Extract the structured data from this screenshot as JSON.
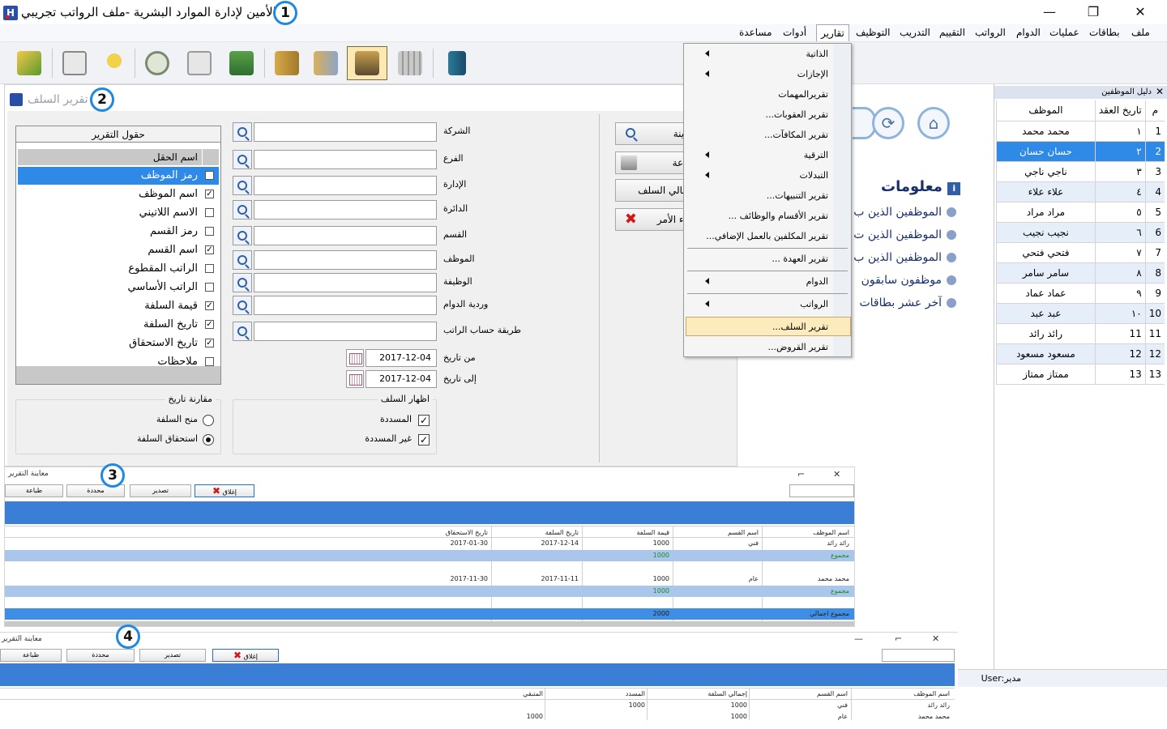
{
  "app": {
    "title": "الأمين لإدارة الموارد البشرية -ملف الرواتب تجريبي",
    "logo_letter": "H"
  },
  "window_controls": {
    "minimize": "—",
    "maximize": "❐",
    "close": "✕"
  },
  "badges": [
    "1",
    "2",
    "3",
    "4"
  ],
  "menubar": [
    "ملف",
    "بطاقات",
    "عمليات",
    "الدوام",
    "الرواتب",
    "التقييم",
    "التدريب",
    "التوظيف",
    "تقارير",
    "أدوات",
    "مساعدة"
  ],
  "toolbar": {
    "icons": [
      "exit-icon",
      "employee-card-icon",
      "pin-icon",
      "clock-icon",
      "schedule-icon",
      "money-icon",
      "books-icon",
      "documents-icon",
      "users-icon",
      "calculator-icon",
      "door-icon"
    ],
    "selected_index": 8
  },
  "reports_menu": {
    "items": [
      {
        "label": "الذاتية",
        "arrow": true
      },
      {
        "label": "الإجازات",
        "arrow": true
      },
      {
        "label": "تقريرالمهمات",
        "arrow": false
      },
      {
        "label": "تقرير العقوبات...",
        "arrow": false
      },
      {
        "label": "تقرير المكافآت...",
        "arrow": false
      },
      {
        "label": "الترقية",
        "arrow": true
      },
      {
        "label": "التبدلات",
        "arrow": true
      },
      {
        "label": "تقرير التنبيهات...",
        "arrow": false
      },
      {
        "label": "تقرير الأقسام والوظائف ...",
        "arrow": false
      },
      {
        "label": "تقرير المكلفين بالعمل الإضافي...",
        "arrow": false
      },
      {
        "label": "تقرير العهدة ...",
        "arrow": false
      },
      {
        "label": "الدوام",
        "arrow": true
      },
      {
        "label": "الرواتب",
        "arrow": true
      },
      {
        "label": "تقرير السلف...",
        "arrow": false
      },
      {
        "label": "تقرير القروض...",
        "arrow": false
      }
    ]
  },
  "home_panel": {
    "info_title": "معلومات",
    "items": [
      "الموظفين الذين ب",
      "الموظفين الذين ت",
      "الموظفين الذين ب",
      "موظفون سابقون",
      "آخر عشر بطاقات"
    ]
  },
  "employee_panel": {
    "title": "دليل الموظفين",
    "columns": [
      "م",
      "تاريخ العقد",
      "الموظف"
    ],
    "rows": [
      {
        "n": "1",
        "contract": "١",
        "name": "محمد محمد"
      },
      {
        "n": "2",
        "contract": "٢",
        "name": "حسان حسان"
      },
      {
        "n": "3",
        "contract": "٣",
        "name": "ناجي ناجي"
      },
      {
        "n": "4",
        "contract": "٤",
        "name": "علاء علاء"
      },
      {
        "n": "5",
        "contract": "٥",
        "name": "مراد مراد"
      },
      {
        "n": "6",
        "contract": "٦",
        "name": "نجيب نجيب"
      },
      {
        "n": "7",
        "contract": "٧",
        "name": "فتحي فتحي"
      },
      {
        "n": "8",
        "contract": "٨",
        "name": "سامر سامر"
      },
      {
        "n": "9",
        "contract": "٩",
        "name": "عماد عماد"
      },
      {
        "n": "10",
        "contract": "١٠",
        "name": "عبد عبد"
      },
      {
        "n": "11",
        "contract": "11",
        "name": "رائد رائد"
      },
      {
        "n": "12",
        "contract": "12",
        "name": "مسعود مسعود"
      },
      {
        "n": "13",
        "contract": "13",
        "name": "ممتاز ممتاز"
      }
    ],
    "selected_index": 1
  },
  "status": {
    "user": "User:مدير"
  },
  "loan_report_window": {
    "title": "تقرير السلف",
    "fields_box_title": "حقول التقرير",
    "fields_header": "اسم الحقل",
    "fields": [
      {
        "label": "رمز الموظف",
        "checked": false
      },
      {
        "label": "اسم الموظف",
        "checked": true
      },
      {
        "label": "الاسم اللاتيني",
        "checked": false
      },
      {
        "label": "رمز القسم",
        "checked": false
      },
      {
        "label": "اسم القسم",
        "checked": true
      },
      {
        "label": "الراتب المقطوع",
        "checked": false
      },
      {
        "label": "الراتب الأساسي",
        "checked": false
      },
      {
        "label": "قيمة السلفة",
        "checked": true
      },
      {
        "label": "تاريخ السلفة",
        "checked": true
      },
      {
        "label": "تاريخ الاستحقاق",
        "checked": true
      },
      {
        "label": "ملاحظات",
        "checked": false
      }
    ],
    "selected_field": 0,
    "filters": [
      "الشركة",
      "الفرع",
      "الإدارة",
      "الدائرة",
      "القسم",
      "الموظف",
      "الوظيفة",
      "وردية الدوام",
      "طريقة حساب الراتب"
    ],
    "from_date_label": "من تاريخ",
    "to_date_label": "إلى تاريخ",
    "from_date": "2017-12-04",
    "to_date": "2017-12-04",
    "date_compare": {
      "title": "مقارنة تاريخ",
      "options": [
        "منح السلفة",
        "استحقاق السلفة"
      ],
      "selected": 1
    },
    "show_loans": {
      "title": "اظهار السلف",
      "options": [
        {
          "label": "المسددة",
          "checked": true
        },
        {
          "label": "غير المسددة",
          "checked": true
        }
      ]
    },
    "actions": [
      "معاينة",
      "طباعة",
      "إجمالي السلف",
      "إلغاء الأمر"
    ]
  },
  "report_preview_1": {
    "title": "معاينة التقرير",
    "buttons": [
      "طباعة",
      "محددة",
      "تصدير",
      "إغلاق"
    ],
    "columns": [
      "اسم الموظف",
      "اسم القسم",
      "قيمة السلفة",
      "تاريخ السلفة",
      "تاريخ الاستحقاق"
    ],
    "rows": [
      {
        "employee": "رائد رائد",
        "dept": "فني",
        "amount": "1000",
        "date": "2017-12-14",
        "due": "2017-01-30"
      },
      {
        "employee": "محمد محمد",
        "dept": "عام",
        "amount": "1000",
        "date": "2017-11-11",
        "due": "2017-11-30"
      }
    ],
    "subtotal_label": "مجموع",
    "subtotals": [
      "1000",
      "1000"
    ],
    "grand_total_label": "مجموع اجمالي",
    "grand_total": "2000"
  },
  "report_preview_2": {
    "title": "معاينة التقرير",
    "buttons": [
      "طباعة",
      "محددة",
      "تصدير",
      "إغلاق"
    ],
    "columns": [
      "اسم الموظف",
      "اسم القسم",
      "إجمالي السلفة",
      "المسدد",
      "المتبقي"
    ],
    "rows": [
      {
        "employee": "رائد رائد",
        "dept": "فني",
        "total": "1000",
        "paid": "1000",
        "remaining": ""
      },
      {
        "employee": "محمد محمد",
        "dept": "عام",
        "total": "1000",
        "paid": "",
        "remaining": "1000"
      }
    ]
  },
  "colors": {
    "accent": "#2e8ae6",
    "menu_highlight": "#fcebbd",
    "badge": "#1e88e5",
    "report_band": "#3a7fd5"
  }
}
